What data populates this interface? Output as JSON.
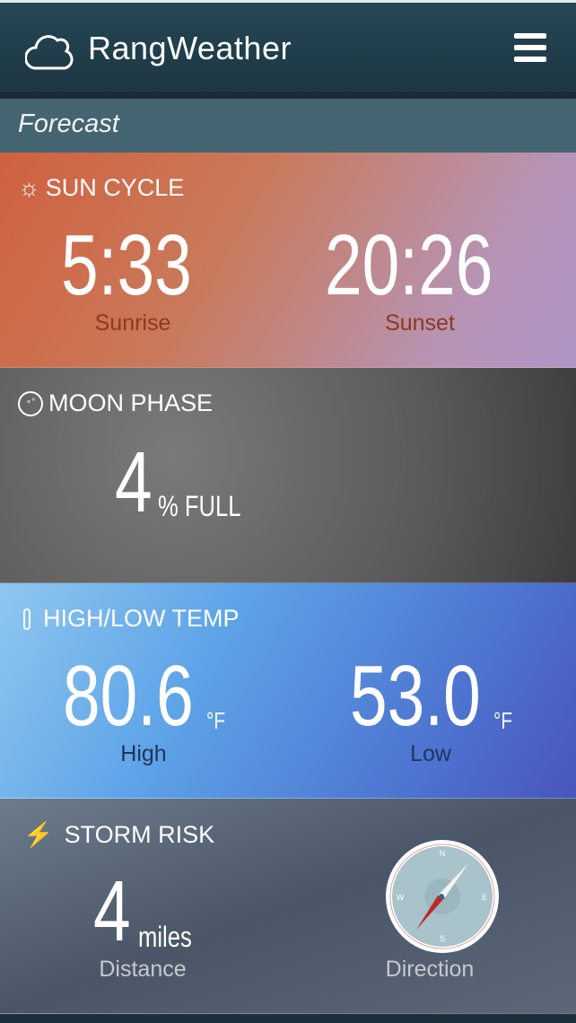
{
  "app": {
    "title": "RangWeather",
    "section": "Forecast"
  },
  "sun": {
    "title": "SUN CYCLE",
    "sunrise": "5:33",
    "sunrise_label": "Sunrise",
    "sunset": "20:26",
    "sunset_label": "Sunset"
  },
  "moon": {
    "title": "MOON PHASE",
    "value": "4",
    "unit": "% FULL"
  },
  "temp": {
    "title": "HIGH/LOW TEMP",
    "high": "80.6",
    "high_unit": "°F",
    "high_label": "High",
    "low": "53.0",
    "low_unit": "°F",
    "low_label": "Low"
  },
  "storm": {
    "title": "STORM RISK",
    "distance": "4",
    "distance_unit": "miles",
    "distance_label": "Distance",
    "direction_label": "Direction",
    "compass": {
      "n": "N",
      "e": "E",
      "s": "S",
      "w": "W"
    }
  }
}
